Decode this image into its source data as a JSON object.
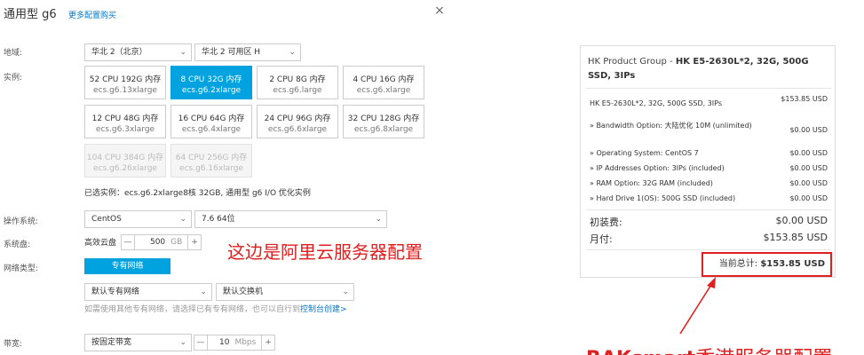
{
  "dialog": {
    "title": "通用型 g6",
    "more_link": "更多配置购买",
    "close": "×"
  },
  "region": {
    "label": "地域:",
    "region_value": "华北 2（北京）",
    "zone_value": "华北 2 可用区 H"
  },
  "instance": {
    "label": "实例:",
    "options": [
      {
        "cpu": "52 CPU  192G 内存",
        "spec": "ecs.g6.13xlarge"
      },
      {
        "cpu": "8 CPU  32G 内存",
        "spec": "ecs.g6.2xlarge"
      },
      {
        "cpu": "2 CPU    8G 内存",
        "spec": "ecs.g6.large"
      },
      {
        "cpu": "4 CPU   16G 内存",
        "spec": "ecs.g6.xlarge"
      },
      {
        "cpu": "12 CPU  48G 内存",
        "spec": "ecs.g6.3xlarge"
      },
      {
        "cpu": "16 CPU  64G 内存",
        "spec": "ecs.g6.4xlarge"
      },
      {
        "cpu": "24 CPU  96G 内存",
        "spec": "ecs.g6.6xlarge"
      },
      {
        "cpu": "32 CPU  128G 内存",
        "spec": "ecs.g6.8xlarge"
      },
      {
        "cpu": "104 CPU 384G 内存",
        "spec": "ecs.g6.26xlarge"
      },
      {
        "cpu": "64 CPU  256G 内存",
        "spec": "ecs.g6.16xlarge"
      }
    ],
    "selected_text": "已选实例：ecs.g6.2xlarge8核 32GB, 通用型 g6 I/O 优化实例"
  },
  "os": {
    "label": "操作系统:",
    "os_value": "CentOS",
    "version_value": "7.6 64位"
  },
  "disk": {
    "label": "系统盘:",
    "type": "高效云盘",
    "size": "500",
    "unit": "GB",
    "minus": "—",
    "plus": "+"
  },
  "network": {
    "label": "网络类型:",
    "vpc_button": "专有网络",
    "vpc_value": "默认专有网络",
    "switch_value": "默认交换机",
    "hint_text": "如需使用其他专有网络，请选择已有专有网络，也可以自行到",
    "hint_link": "控制台创建>"
  },
  "bandwidth": {
    "label": "带宽:",
    "type_value": "按固定带宽",
    "value": "10",
    "unit": "Mbps",
    "minus": "—",
    "plus": "+"
  },
  "annotation_aliyun": "这边是阿里云服务器配置",
  "cart": {
    "title_prefix": "HK Product Group - ",
    "title_bold": "HK E5-2630L*2, 32G, 500G SSD, 3IPs",
    "items": [
      {
        "name": "HK E5-2630L*2, 32G, 500G SSD, 3IPs",
        "price": "$153.85 USD"
      },
      {
        "name": "» Bandwidth Option: 大陆优化 10M (unlimited)",
        "price": "$0.00 USD"
      },
      {
        "name": "» Operating System: CentOS 7",
        "price": "$0.00 USD"
      },
      {
        "name": "» IP Addresses Option: 3IPs (included)",
        "price": "$0.00 USD"
      },
      {
        "name": "» RAM Option: 32G RAM (included)",
        "price": "$0.00 USD"
      },
      {
        "name": "» Hard Drive 1(OS): 500G SSD (included)",
        "price": "$0.00 USD"
      }
    ],
    "setup_label": "初装费:",
    "setup_value": "$0.00 USD",
    "monthly_label": "月付:",
    "monthly_value": "$153.85 USD",
    "total_label": "当前总计:",
    "total_value": "$153.85 USD"
  },
  "annotation_rak": {
    "brand": "RAKsmart",
    "cn": "香港服务器配置"
  },
  "colors": {
    "accent": "#00a2e0",
    "link": "#0077c8",
    "annotation": "#e02020"
  }
}
